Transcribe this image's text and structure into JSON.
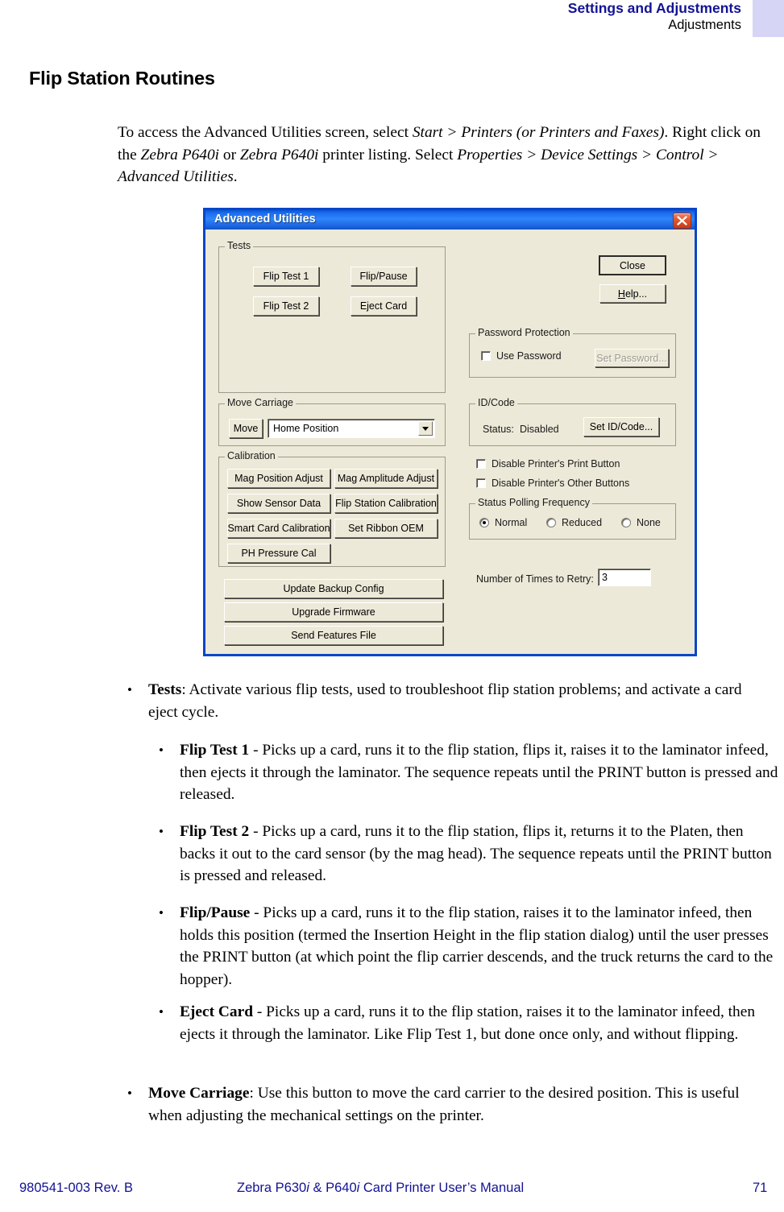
{
  "runhead": {
    "chapter": "Settings and Adjustments",
    "section": "Adjustments"
  },
  "heading": "Flip Station Routines",
  "intro": {
    "part1": "To access the Advanced Utilities screen, select ",
    "i1": "Start > Printers (or Printers and Faxes)",
    "part2": ". Right click on the ",
    "i2": "Zebra P640i",
    "part3": " or ",
    "i3": "Zebra P640i",
    "part4": " printer listing. Select ",
    "i4": "Properties > Device Settings > Control > Advanced Utilities",
    "part5": "."
  },
  "dialog": {
    "title": "Advanced Utilities",
    "close_icon": "close-icon",
    "tests": {
      "legend": "Tests",
      "buttons": [
        "Flip Test 1",
        "Flip/Pause",
        "Flip Test 2",
        "Eject Card"
      ]
    },
    "actions": {
      "close": "Close",
      "help_accel": "H",
      "help_rest": "elp..."
    },
    "password": {
      "legend": "Password Protection",
      "checkbox_label": "Use Password",
      "checkbox_checked": false,
      "set_button": "Set Password...",
      "set_button_disabled": true
    },
    "move_carriage": {
      "legend_a": "Move Carria",
      "legend_accel": "g",
      "legend_b": "e",
      "button": "Move",
      "combo_value": "Home Position"
    },
    "idcode": {
      "legend": "ID/Code",
      "status_label": "Status:",
      "status_value": "Disabled",
      "button": "Set ID/Code..."
    },
    "printer_buttons": [
      {
        "label": "Disable Printer's Print Button",
        "checked": false
      },
      {
        "label": "Disable Printer's Other Buttons",
        "checked": false
      }
    ],
    "polling": {
      "legend": "Status Polling Frequency",
      "options": [
        "Normal",
        "Reduced",
        "None"
      ],
      "selected": "Normal"
    },
    "retry": {
      "label": "Number of Times to Retry:",
      "value": "3"
    },
    "calibration": {
      "legend": "Calibration",
      "buttons": [
        "Mag Position Adjust",
        "Mag Amplitude Adjust",
        "Show Sensor Data",
        "Flip Station Calibration",
        "Smart Card Calibration",
        "Set Ribbon OEM",
        "PH Pressure Cal"
      ]
    },
    "wide_buttons": [
      "Update Backup Config",
      "Upgrade Firmware",
      "Send Features File"
    ]
  },
  "bullets": {
    "tests_term": "Tests",
    "tests_body": ": Activate various flip tests, used to troubleshoot flip station problems; and activate a card eject cycle.",
    "flip1_term": "Flip Test 1",
    "flip1_body": " - Picks up a card, runs it to the flip station, flips it, raises it to the laminator infeed, then ejects it through the laminator. The sequence repeats until the PRINT button is pressed and released.",
    "flip2_term": "Flip Test 2",
    "flip2_body": " - Picks up a card, runs it to the flip station, flips it, returns it to the Platen, then backs it out to the card sensor (by the mag head). The sequence repeats until the PRINT button is pressed and released.",
    "flippause_term": "Flip/Pause",
    "flippause_body": " - Picks up a card, runs it to the flip station, raises it to the laminator infeed, then holds this position (termed the Insertion Height in the flip station dialog) until the user presses the PRINT button (at which point the flip carrier descends, and the truck returns the card to the hopper).",
    "eject_term": "Eject Card",
    "eject_body": " - Picks up a card, runs it to the flip station, raises it to the laminator infeed, then ejects it through the laminator. Like Flip Test 1, but done once only, and without flipping.",
    "move_term": "Move Carriage",
    "move_body": ": Use this button to move the card carrier to the desired position. This is useful when adjusting the mechanical settings on the printer.",
    "marker": "•"
  },
  "footer": {
    "left": "980541-003 Rev. B",
    "center_a": "Zebra P630",
    "center_i1": "i",
    "center_b": " & P640",
    "center_i2": "i",
    "center_c": " Card Printer User’s Manual",
    "page": "71"
  }
}
